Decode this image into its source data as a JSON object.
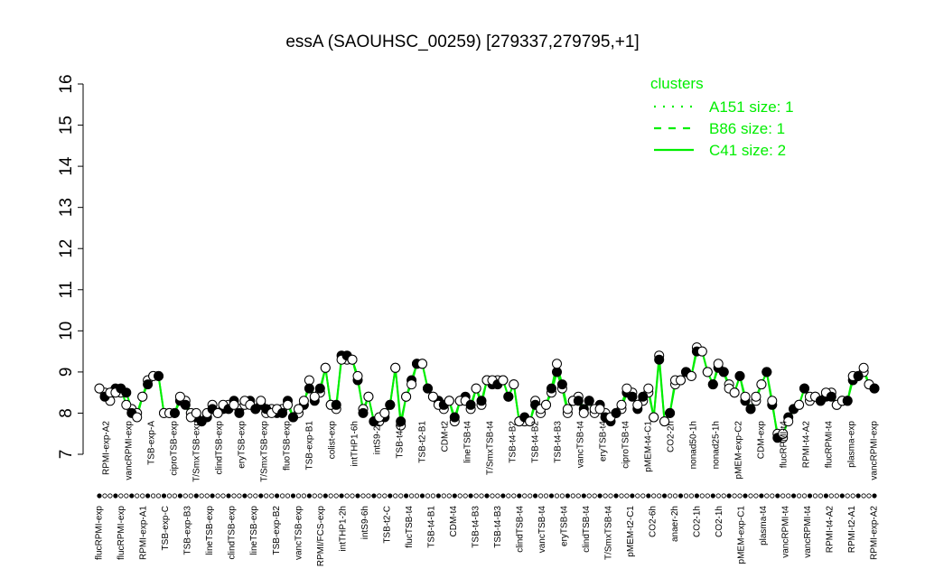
{
  "chart_data": {
    "type": "line",
    "title": "essA (SAOUHSC_00259) [279337,279795,+1]",
    "xlabel": "",
    "ylabel": "",
    "ylim": [
      7,
      16
    ],
    "yticks": [
      "7",
      "8",
      "9",
      "10",
      "11",
      "12",
      "13",
      "14",
      "15",
      "16"
    ],
    "grid": false,
    "line_color": "#00ee00",
    "legend": {
      "title": "clusters",
      "placement": "top-right",
      "entries": [
        {
          "label": "A151 size: 1",
          "style": "dotted"
        },
        {
          "label": "B86 size: 1",
          "style": "dashed"
        },
        {
          "label": "C41 size: 2",
          "style": "solid"
        }
      ]
    },
    "top_labels": [
      "RPMI-exp-A2",
      "vancRPMI-exp",
      "TSB-exp-A",
      "ciproTSB-exp",
      "T/SmxTSB-exp",
      "clindTSB-exp",
      "eryTSB-exp",
      "T/SmxTSB-exp",
      "fluoTSB-exp",
      "TSB-exp-B1",
      "colist-exp",
      "intTHP1-6h",
      "intS9-2h",
      "TSB-t4-C",
      "TSB-t2-B1",
      "CDM-t2",
      "lineTSB-t4",
      "T/SmxTSB-t4",
      "TSB-t4-B2",
      "TSB-t4-B2",
      "TSB-t4-B3",
      "vancTSB-t4",
      "eryTSB-t4",
      "ciproTSB-t4",
      "pMEM-t4-C1",
      "CO2-2h",
      "nonad50-1h",
      "nonad25-1h",
      "pMEM-exp-C2",
      "CDM-exp",
      "flucRPMI-t4",
      "RPMI-t4-A2",
      "flucRPMI-t4",
      "plasma-exp",
      "vancRPMI-exp"
    ],
    "bottom_labels": [
      "flucRPMI-exp",
      "flucRPMI-exp",
      "RPMI-exp-A1",
      "TSB-exp-C",
      "TSB-exp-B3",
      "lineTSB-exp",
      "clindTSB-exp",
      "lineTSB-exp",
      "TSB-exp-B2",
      "vancTSB-exp",
      "RPMI/FCS-exp",
      "intTHP1-2h",
      "intS9-6h",
      "TSB-t2-C",
      "flucTSB-t4",
      "TSB-t4-B1",
      "CDM-t4",
      "TSB-t4-B3",
      "TSB-t4-B3",
      "clindTSB-t4",
      "vancTSB-t4",
      "eryTSB-t4",
      "clindTSB-t4",
      "T/SmxTSB-t4",
      "pMEM-t2-C1",
      "CO2-6h",
      "anaer-2h",
      "CO2-1h",
      "CO2-1h",
      "pMEM-exp-C1",
      "plasma-t4",
      "vancRPMI-t4",
      "vancRPMI-t4",
      "RPMI-t4-A2",
      "RPMI-t2-A1",
      "RPMI-exp-A2"
    ],
    "series": [
      {
        "style": "solid",
        "values": [
          8.6,
          8.5,
          8.3,
          8.6,
          8.5,
          8.5,
          8.1,
          8.0,
          8.4,
          8.8,
          8.9,
          8.9,
          8.0,
          8.0,
          8.0,
          8.3,
          8.3,
          8.0,
          7.9,
          7.8,
          7.9,
          8.2,
          8.0,
          8.1,
          8.2,
          8.3,
          8.1,
          8.2,
          8.3,
          8.1,
          8.2,
          8.0,
          8.1,
          8.0,
          8.1,
          8.3,
          7.9,
          8.0,
          8.2,
          8.8,
          8.3,
          8.5,
          9.1,
          8.2,
          8.1,
          9.4,
          9.3,
          9.3,
          8.8,
          8.1,
          8.4,
          7.8,
          7.8,
          7.9,
          8.2,
          9.1,
          7.7,
          8.4,
          8.8,
          9.2,
          9.2,
          8.6,
          8.4,
          8.3,
          8.1,
          8.3,
          7.8,
          8.3,
          8.4,
          8.1,
          8.6,
          8.2,
          8.8,
          8.7,
          8.8,
          8.8,
          8.4,
          8.7,
          7.8,
          7.8,
          7.8,
          8.3,
          8.0,
          8.2,
          8.5,
          9.0,
          8.6,
          8.0,
          8.3,
          8.4,
          8.1,
          8.3,
          8.0,
          8.2,
          8.0,
          7.8,
          8.0,
          8.1,
          8.5,
          8.5,
          8.1,
          8.3,
          8.5,
          7.9,
          9.4,
          7.8,
          8.0,
          8.7,
          8.8,
          9.0,
          8.9,
          9.6,
          9.5,
          9.0,
          8.7,
          9.1,
          9.0,
          8.7,
          8.5,
          8.9,
          8.3,
          8.1,
          8.3,
          8.7,
          9.0,
          8.2,
          7.5,
          7.4,
          7.9,
          8.1,
          8.2,
          8.6,
          8.3,
          8.4,
          8.3,
          8.4,
          8.5,
          8.2,
          8.3,
          8.3,
          8.8,
          8.9,
          9.0,
          8.7,
          8.6
        ]
      },
      {
        "style": "solid",
        "values": [
          8.6,
          8.4,
          8.5,
          8.5,
          8.6,
          8.2,
          8.0,
          7.9,
          8.4,
          8.7,
          8.9,
          8.9,
          8.0,
          8.0,
          8.0,
          8.4,
          8.2,
          7.9,
          8.0,
          7.8,
          8.0,
          8.1,
          8.0,
          8.2,
          8.1,
          8.2,
          8.0,
          8.3,
          8.2,
          8.1,
          8.3,
          8.1,
          8.0,
          8.1,
          8.0,
          8.2,
          7.9,
          8.1,
          8.3,
          8.6,
          8.4,
          8.6,
          9.1,
          8.2,
          8.2,
          9.3,
          9.4,
          9.3,
          8.9,
          8.0,
          8.4,
          7.8,
          7.9,
          8.0,
          8.2,
          9.1,
          7.8,
          8.4,
          8.7,
          9.2,
          9.2,
          8.6,
          8.4,
          8.2,
          8.2,
          8.3,
          7.9,
          8.3,
          8.3,
          8.2,
          8.6,
          8.3,
          8.8,
          8.8,
          8.7,
          8.8,
          8.4,
          8.7,
          7.8,
          7.9,
          7.8,
          8.2,
          8.1,
          8.2,
          8.6,
          9.2,
          8.7,
          8.1,
          8.3,
          8.3,
          8.0,
          8.3,
          8.1,
          8.1,
          7.9,
          7.9,
          8.0,
          8.2,
          8.6,
          8.4,
          8.2,
          8.4,
          8.6,
          7.9,
          9.3,
          7.8,
          8.0,
          8.8,
          8.8,
          9.0,
          8.9,
          9.5,
          9.5,
          9.0,
          8.7,
          9.2,
          9.0,
          8.6,
          8.5,
          8.9,
          8.4,
          8.1,
          8.4,
          8.7,
          9.0,
          8.3,
          7.4,
          7.5,
          7.8,
          8.1,
          8.2,
          8.6,
          8.4,
          8.4,
          8.3,
          8.5,
          8.4,
          8.2,
          8.3,
          8.3,
          8.9,
          8.9,
          9.1,
          8.7,
          8.6
        ]
      }
    ]
  }
}
